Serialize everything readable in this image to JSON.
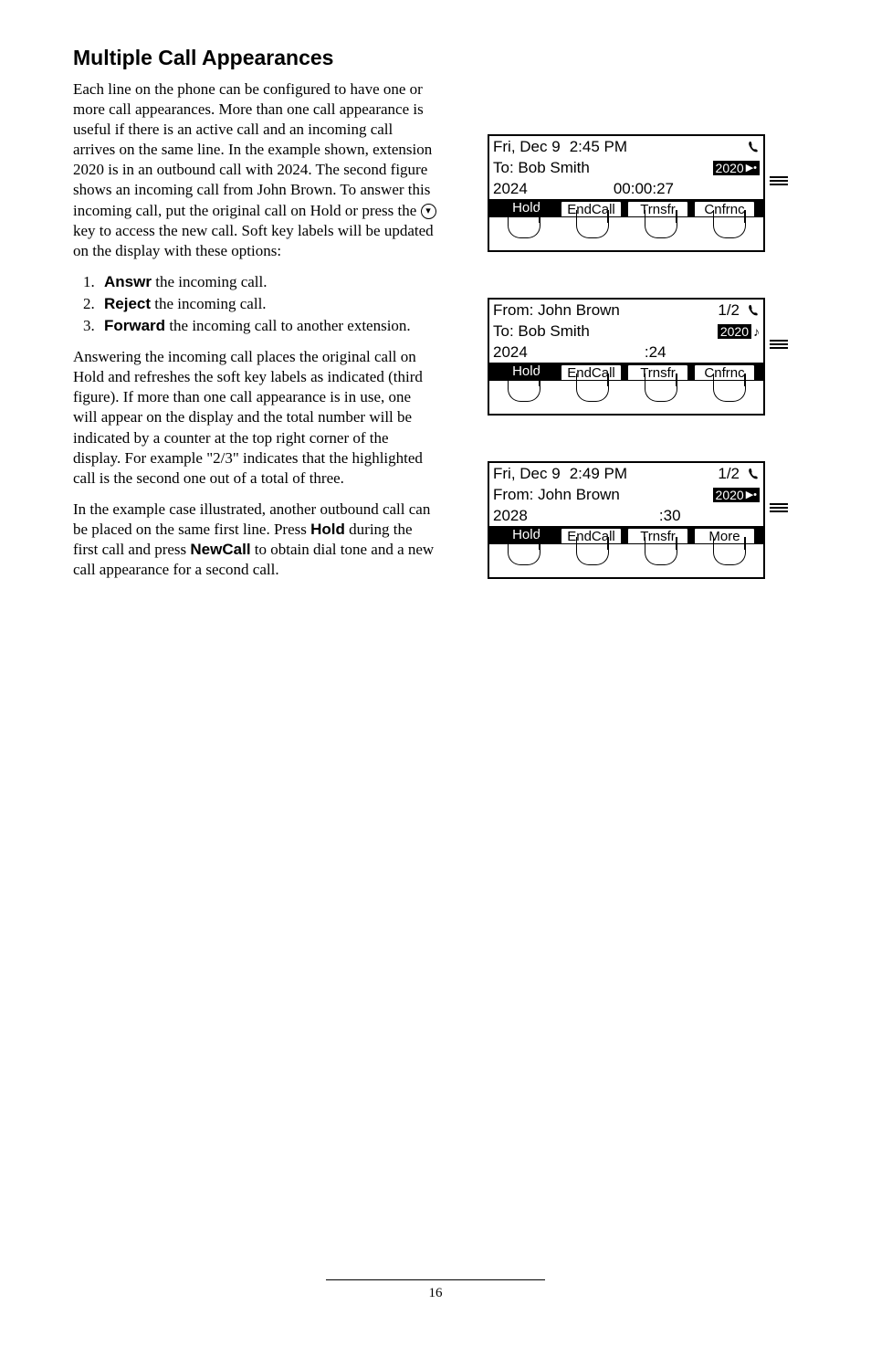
{
  "heading": "Multiple Call Appearances",
  "p1a": "Each line on the phone can be configured to have one or more call appearances.  More than one call appearance is useful if there is an active call and an incoming call arrives on the same line.  In the example shown, extension 2020 is in an outbound call with 2024.  The second figure shows an incoming call from John Brown.  To answer this incoming call, put the original call on Hold or press the ",
  "p1b": " key to access the new call.  Soft key labels will be updated on the display with these options:",
  "circled_glyph": "▾",
  "steps": [
    {
      "b": "Answr",
      "t": " the incoming call."
    },
    {
      "b": "Reject",
      "t": " the incoming call."
    },
    {
      "b": "Forward",
      "t": " the incoming call to another extension."
    }
  ],
  "p2": "Answering the incoming call places the original call on Hold and refreshes the soft key labels as indicated (third figure).  If more than one call appearance is in use, one will appear on the display and the total number will be indicated by a counter at the top right corner of the display.  For example \"2/3\" indicates that the highlighted call is the second one out of a total of three.",
  "p3a": "In the example case illustrated,  another outbound call can be placed on the same first line.  Press ",
  "p3_hold": "Hold",
  "p3b": " during the first call and press ",
  "p3_newcall": "NewCall",
  "p3c": " to obtain dial tone and a new call appearance for a second call.",
  "screens": [
    {
      "line1": [
        "Fri, Dec 9",
        "2:45 PM",
        "",
        ""
      ],
      "line2": [
        "To: Bob Smith",
        "",
        "",
        "2020"
      ],
      "line2_badge_icon": "spk",
      "line3": [
        "2024",
        "",
        "00:00:27",
        ""
      ],
      "softkeys": [
        "Hold",
        "EndCall",
        "Trnsfr",
        "Cnfrnc"
      ]
    },
    {
      "line1": [
        "From: John Brown",
        "",
        "1/2",
        ""
      ],
      "line2": [
        "To: Bob Smith",
        "",
        "",
        "2020"
      ],
      "line2_badge_icon": "note",
      "line3": [
        "2024",
        "",
        ":24",
        ""
      ],
      "softkeys": [
        "Hold",
        "EndCall",
        "Trnsfr",
        "Cnfrnc"
      ]
    },
    {
      "line1": [
        "Fri, Dec 9",
        "2:49 PM",
        "1/2",
        ""
      ],
      "line2": [
        "From: John Brown",
        "",
        "",
        "2020"
      ],
      "line2_badge_icon": "spk",
      "line3": [
        "2028",
        "",
        ":30",
        ""
      ],
      "softkeys": [
        "Hold",
        "EndCall",
        "Trnsfr",
        "More"
      ]
    }
  ],
  "page_number": "16"
}
